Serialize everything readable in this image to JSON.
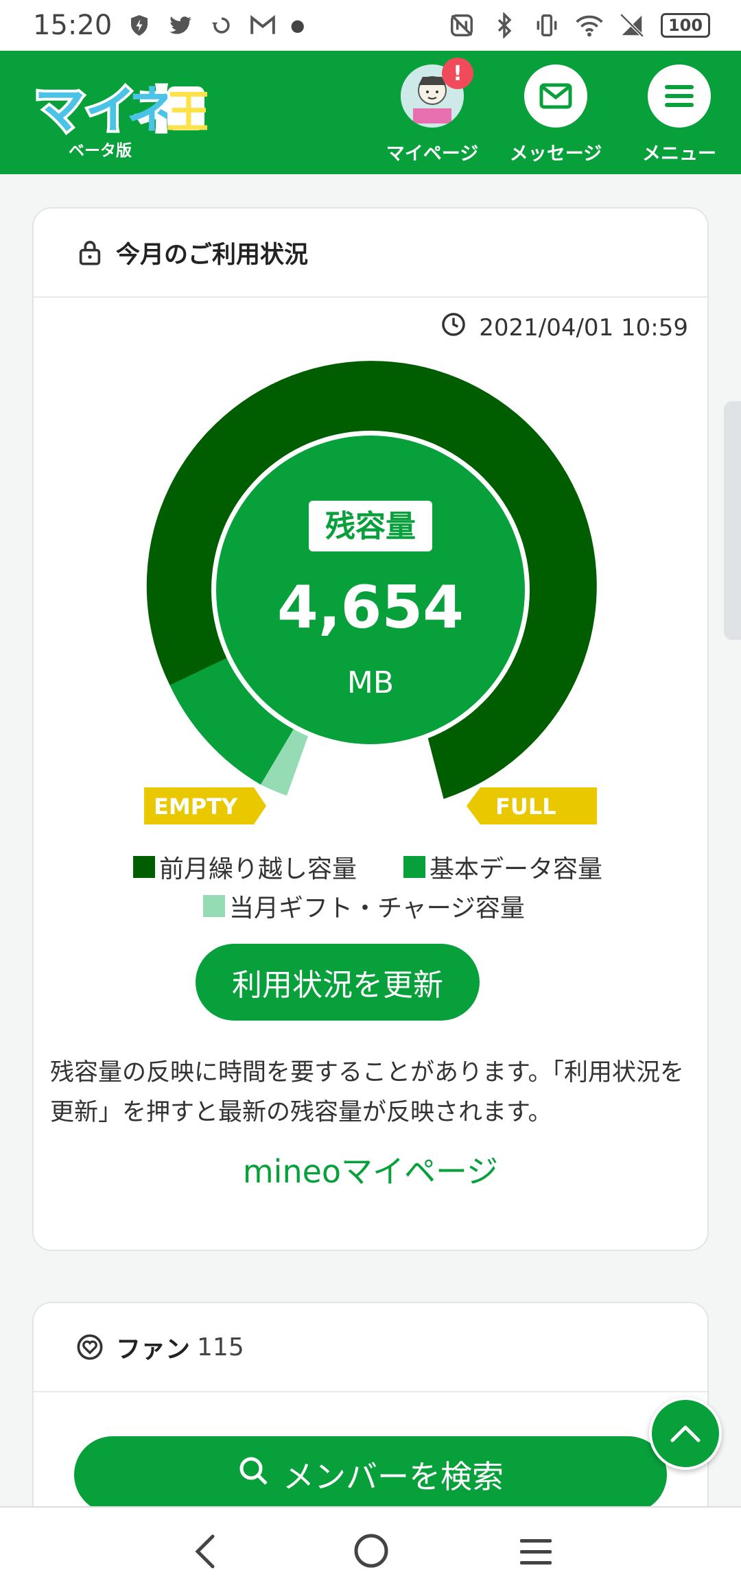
{
  "status_bar": {
    "time": "15:20",
    "battery": "100"
  },
  "header": {
    "logo_sub": "ベータ版",
    "mypage_label": "マイページ",
    "mypage_badge": "!",
    "message_label": "メッセージ",
    "menu_label": "メニュー"
  },
  "usage_card": {
    "title": "今月のご利用状況",
    "timestamp": "2021/04/01 10:59",
    "remaining_label": "残容量",
    "remaining_value": "4,654",
    "remaining_unit": "MB",
    "empty_label": "EMPTY",
    "full_label": "FULL",
    "legend": [
      {
        "label": "前月繰り越し容量",
        "color": "#005d00"
      },
      {
        "label": "基本データ容量",
        "color": "#07a03b"
      },
      {
        "label": "当月ギフト・チャージ容量",
        "color": "#95dcb4"
      }
    ],
    "update_button": "利用状況を更新",
    "note": "残容量の反映に時間を要することがあります。「利用状況を更新」を押すと最新の残容量が反映されます。",
    "mypage_link": "mineoマイページ"
  },
  "fan_card": {
    "title": "ファン",
    "count": "115",
    "search_button": "メンバーを検索"
  },
  "colors": {
    "brand_green": "#07a03b",
    "dark_green": "#005d00",
    "light_green": "#95dcb4",
    "tag_yellow": "#e9c800"
  }
}
